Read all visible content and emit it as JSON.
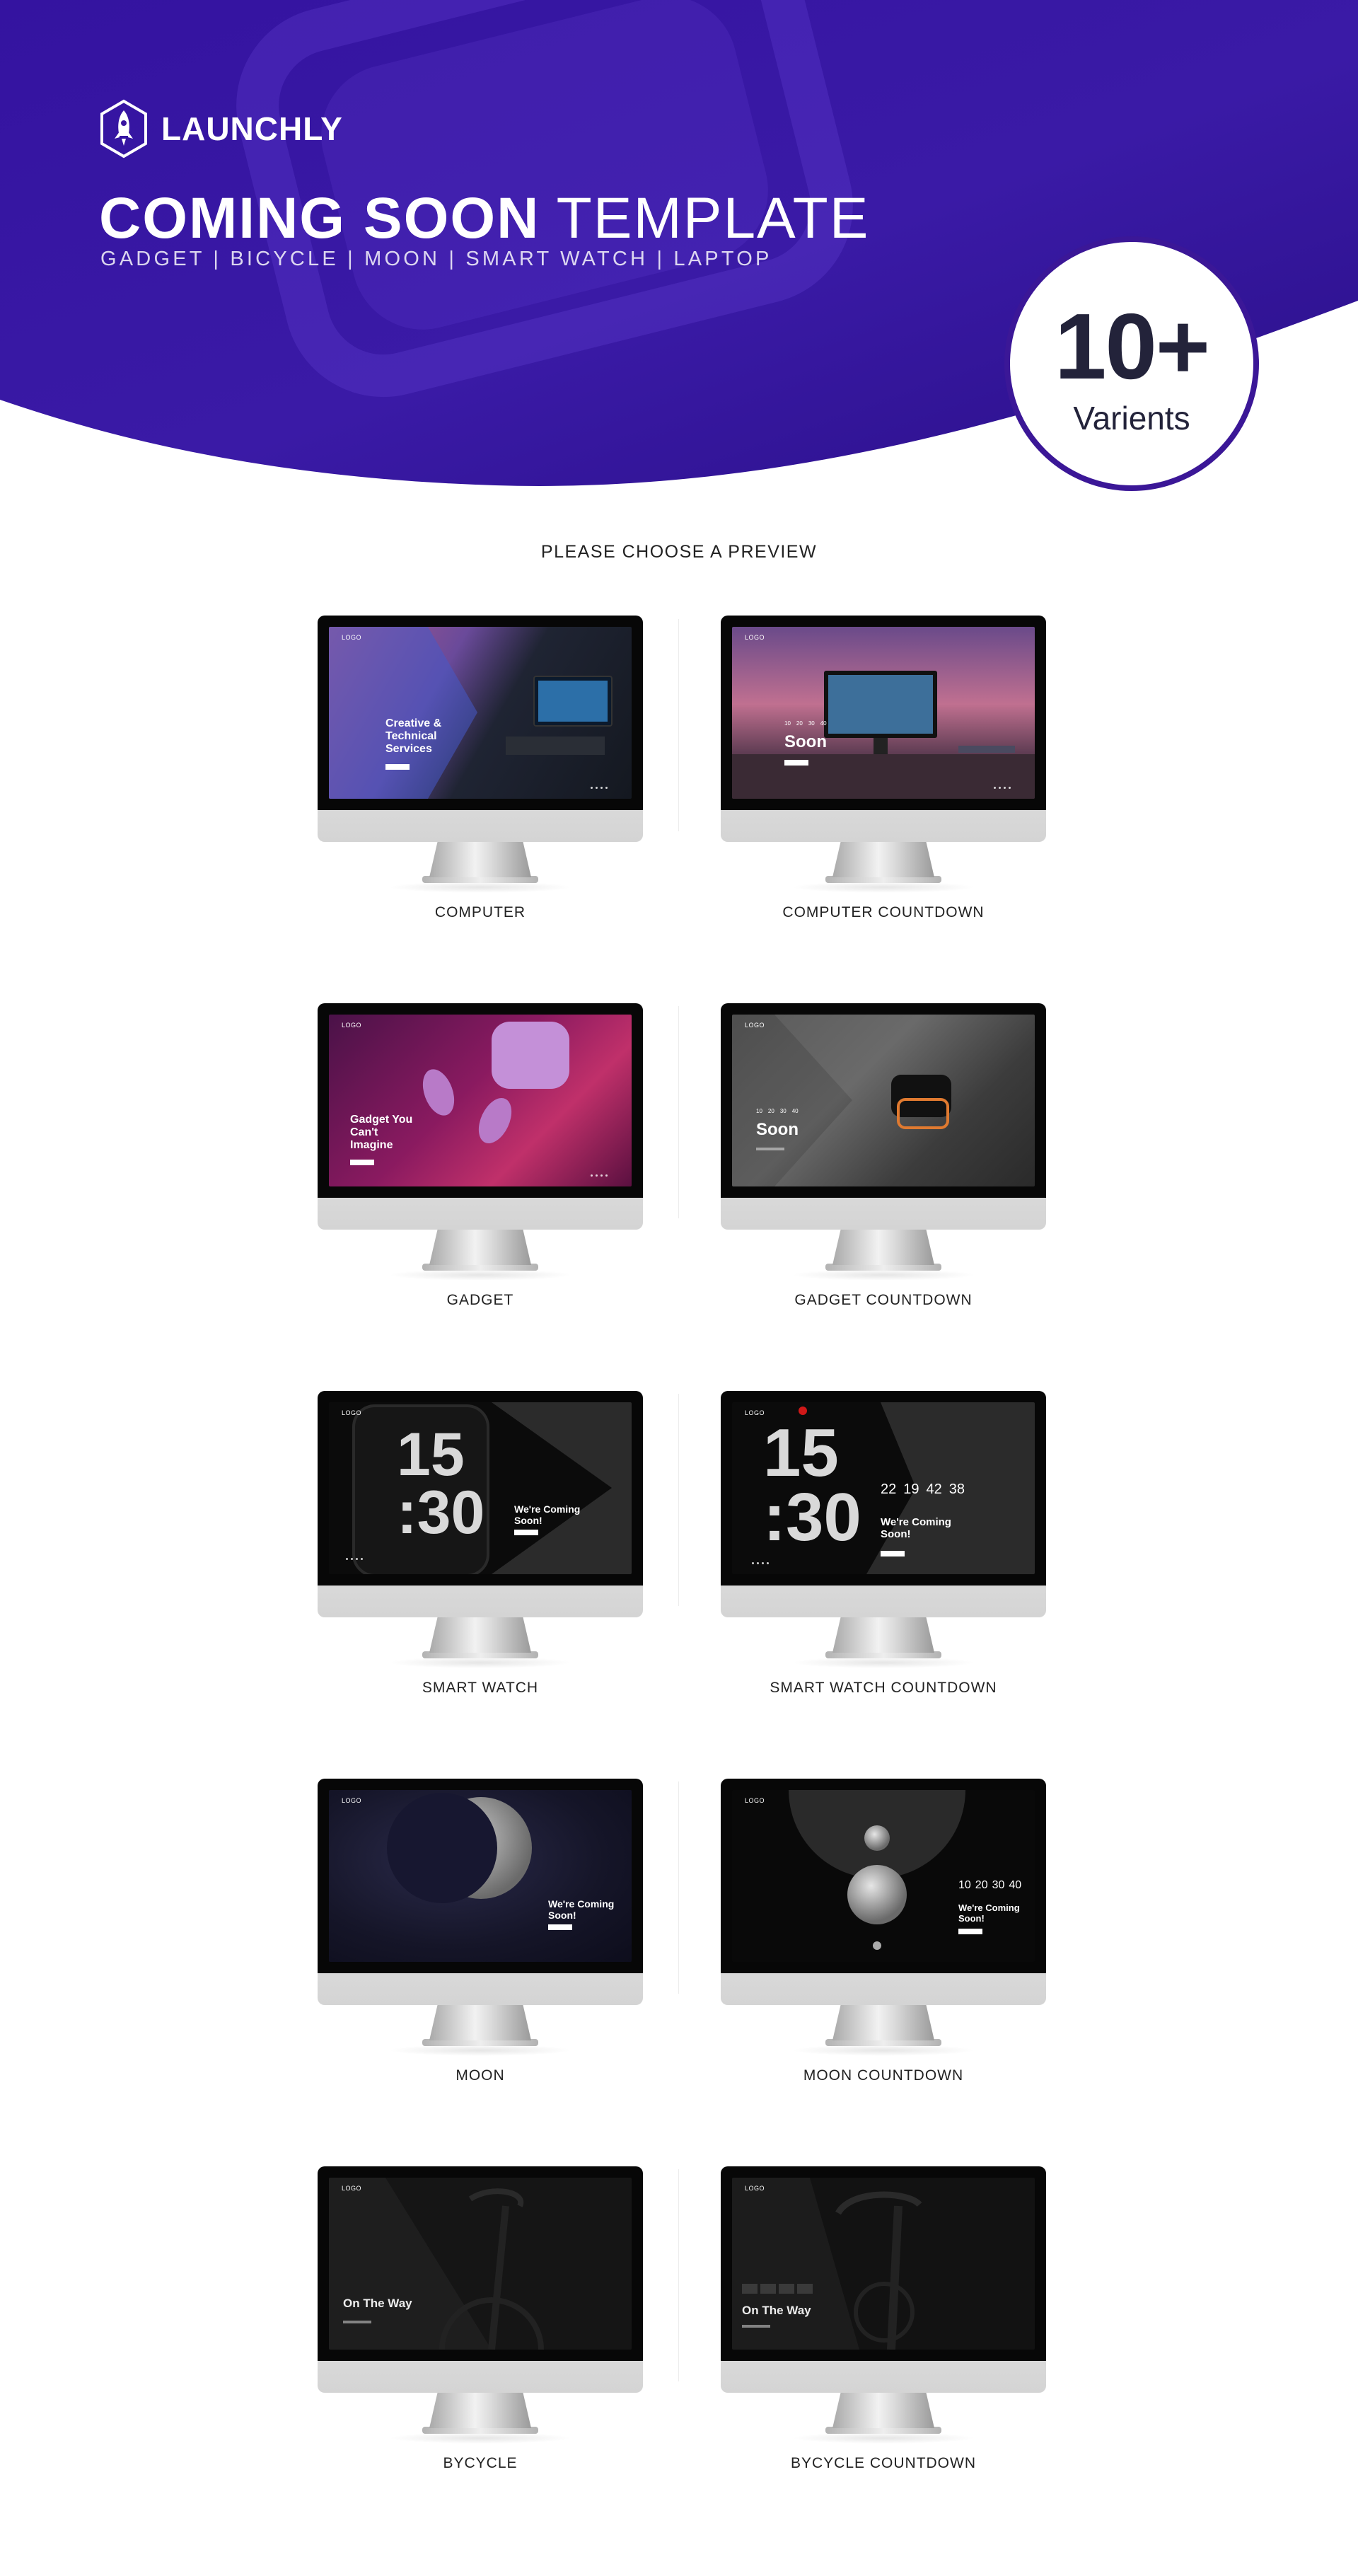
{
  "brand": {
    "name": "LAUNCHLY"
  },
  "hero": {
    "title_bold": "COMING SOON",
    "title_light": "TEMPLATE",
    "subtitle": "GADGET | BICYCLE | MOON | SMART WATCH | LAPTOP"
  },
  "badge": {
    "number": "10+",
    "label": "Varients"
  },
  "section": {
    "heading": "PLEASE CHOOSE A PREVIEW"
  },
  "colors": {
    "hero_purple": "#3a14a0",
    "hero_purple_dark": "#2b0f86",
    "badge_ring": "#3b1797",
    "text_dark": "#23233a"
  },
  "previews": [
    {
      "label": "COMPUTER",
      "logo": "LOGO",
      "headline": "Creative & Technical Services"
    },
    {
      "label": "COMPUTER COUNTDOWN",
      "logo": "LOGO",
      "headline": "Soon"
    },
    {
      "label": "GADGET",
      "logo": "LOGO",
      "headline": "Gadget You Can't Imagine"
    },
    {
      "label": "GADGET COUNTDOWN",
      "logo": "LOGO",
      "headline": "Soon"
    },
    {
      "label": "SMART WATCH",
      "logo": "LOGO",
      "headline": "We're Coming Soon!",
      "big": "15\n:30"
    },
    {
      "label": "SMART WATCH COUNTDOWN",
      "logo": "LOGO",
      "headline": "We're Coming Soon!",
      "big": "15\n:30",
      "countdown": [
        "22",
        "19",
        "42",
        "38"
      ]
    },
    {
      "label": "MOON",
      "logo": "LOGO",
      "headline": "We're Coming Soon!"
    },
    {
      "label": "MOON COUNTDOWN",
      "logo": "LOGO",
      "headline": "We're Coming Soon!",
      "countdown": [
        "10",
        "20",
        "30",
        "40"
      ]
    },
    {
      "label": "BYCYCLE",
      "logo": "LOGO",
      "headline": "On The Way"
    },
    {
      "label": "BYCYCLE COUNTDOWN",
      "logo": "LOGO",
      "headline": "On The Way"
    }
  ]
}
